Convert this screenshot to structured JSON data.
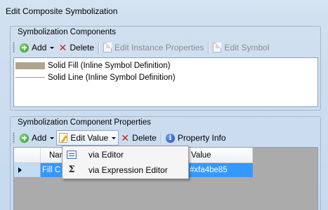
{
  "window": {
    "title": "Edit Composite Symbolization"
  },
  "components_group": {
    "title": "Symbolization Components",
    "toolbar": {
      "add_label": "Add",
      "delete_label": "Delete",
      "edit_instance_label": "Edit Instance Properties",
      "edit_symbol_label": "Edit Symbol"
    },
    "items": [
      {
        "label": "Solid Fill (Inline Symbol Definition)",
        "swatch": "fill",
        "color": "#aea58c"
      },
      {
        "label": "Solid Line (Inline Symbol Definition)",
        "swatch": "line",
        "color": "#9b9b9b"
      }
    ]
  },
  "properties_group": {
    "title": "Symbolization Component Properties",
    "toolbar": {
      "add_label": "Add",
      "edit_value_label": "Edit Value",
      "delete_label": "Delete",
      "property_info_label": "Property Info"
    },
    "grid": {
      "columns": [
        "Name",
        "Value"
      ],
      "rows": [
        {
          "name": "Fill C",
          "value": "#xfa4be85"
        }
      ]
    }
  },
  "edit_value_menu": {
    "items": [
      {
        "label": "via Editor",
        "icon": "form-icon"
      },
      {
        "label": "via Expression Editor",
        "icon": "sigma-icon"
      }
    ]
  },
  "colors": {
    "selection": "#3399ff",
    "row_header": "#c2dcf3",
    "grid_background": "#ababab"
  }
}
